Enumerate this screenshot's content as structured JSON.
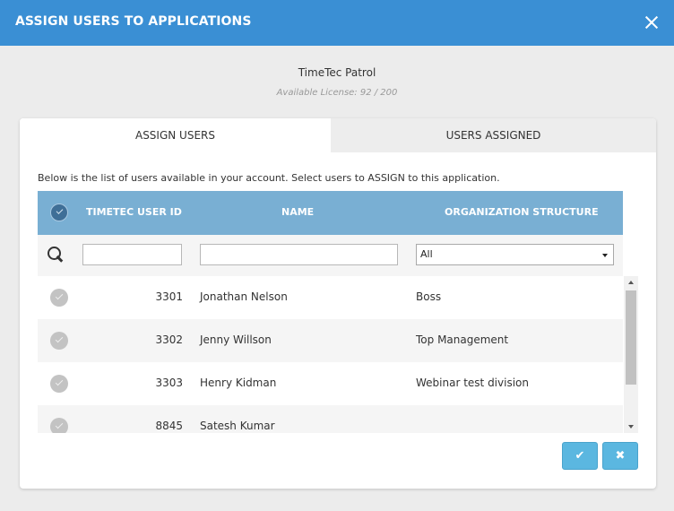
{
  "modal": {
    "title": "ASSIGN USERS TO APPLICATIONS",
    "close_icon": "close-icon"
  },
  "application": {
    "name": "TimeTec Patrol",
    "license": "Available License: 92 / 200"
  },
  "tabs": [
    {
      "label": "ASSIGN USERS",
      "active": true
    },
    {
      "label": "USERS ASSIGNED",
      "active": false
    }
  ],
  "instruction": "Below is the list of users available in your account. Select users to ASSIGN to this application.",
  "table": {
    "columns": [
      "TIMETEC USER ID",
      "NAME",
      "ORGANIZATION STRUCTURE"
    ],
    "filters": {
      "user_id": "",
      "name": "",
      "organization": "All"
    },
    "rows": [
      {
        "id": "3301",
        "name": "Jonathan Nelson",
        "org": "Boss"
      },
      {
        "id": "3302",
        "name": "Jenny Willson",
        "org": "Top Management"
      },
      {
        "id": "3303",
        "name": "Henry Kidman",
        "org": "Webinar test division"
      },
      {
        "id": "8845",
        "name": "Satesh Kumar",
        "org": ""
      }
    ]
  },
  "buttons": {
    "confirm_icon": "check-icon",
    "cancel_icon": "times-icon",
    "confirm_glyph": "✔",
    "cancel_glyph": "✖"
  },
  "colors": {
    "header": "#3a8fd4",
    "table_header": "#79afd3",
    "button": "#5bb7e0"
  }
}
